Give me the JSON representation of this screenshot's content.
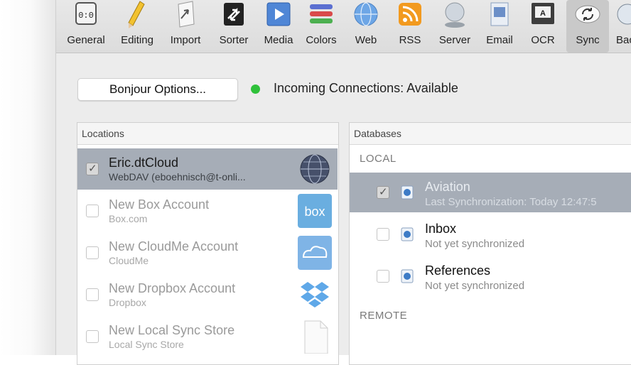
{
  "toolbar": {
    "items": [
      {
        "label": "General",
        "icon": "general-icon",
        "selected": false
      },
      {
        "label": "Editing",
        "icon": "pencil-icon",
        "selected": false
      },
      {
        "label": "Import",
        "icon": "import-icon",
        "selected": false
      },
      {
        "label": "Sorter",
        "icon": "sorter-icon",
        "selected": false
      },
      {
        "label": "Media",
        "icon": "media-icon",
        "selected": false
      },
      {
        "label": "Colors",
        "icon": "colors-icon",
        "selected": false
      },
      {
        "label": "Web",
        "icon": "globe-icon",
        "selected": false
      },
      {
        "label": "RSS",
        "icon": "rss-icon",
        "selected": false
      },
      {
        "label": "Server",
        "icon": "server-icon",
        "selected": false
      },
      {
        "label": "Email",
        "icon": "email-icon",
        "selected": false
      },
      {
        "label": "OCR",
        "icon": "ocr-icon",
        "selected": false
      },
      {
        "label": "Sync",
        "icon": "sync-icon",
        "selected": true
      },
      {
        "label": "Bac",
        "icon": "backup-icon",
        "selected": false
      }
    ]
  },
  "bonjour": {
    "button_label": "Bonjour Options..."
  },
  "status": {
    "text": "Incoming Connections: Available",
    "color": "#2fc13a"
  },
  "locations": {
    "header": "Locations",
    "items": [
      {
        "title": "Eric.dtCloud",
        "subtitle": "WebDAV (eboehnisch@t-onli...",
        "checked": true,
        "selected": true,
        "icon": "globe-icon"
      },
      {
        "title": "New Box Account",
        "subtitle": "Box.com",
        "checked": false,
        "selected": false,
        "icon": "box-icon"
      },
      {
        "title": "New CloudMe Account",
        "subtitle": "CloudMe",
        "checked": false,
        "selected": false,
        "icon": "cloudme-icon"
      },
      {
        "title": "New Dropbox Account",
        "subtitle": "Dropbox",
        "checked": false,
        "selected": false,
        "icon": "dropbox-icon"
      },
      {
        "title": "New Local Sync Store",
        "subtitle": "Local Sync Store",
        "checked": false,
        "selected": false,
        "icon": "document-icon"
      }
    ]
  },
  "databases": {
    "header": "Databases",
    "local_label": "LOCAL",
    "remote_label": "REMOTE",
    "items": [
      {
        "title": "Aviation",
        "subtitle": "Last Synchronization: Today 12:47:5",
        "checked": true,
        "selected": true
      },
      {
        "title": "Inbox",
        "subtitle": "Not yet synchronized",
        "checked": false,
        "selected": false
      },
      {
        "title": "References",
        "subtitle": "Not yet synchronized",
        "checked": false,
        "selected": false
      }
    ]
  },
  "icons": {
    "box_text": "box",
    "ocr_text": "A",
    "general_text": "0:0"
  },
  "colors": {
    "selection": "#a6adb7",
    "accent_green": "#2fc13a"
  }
}
